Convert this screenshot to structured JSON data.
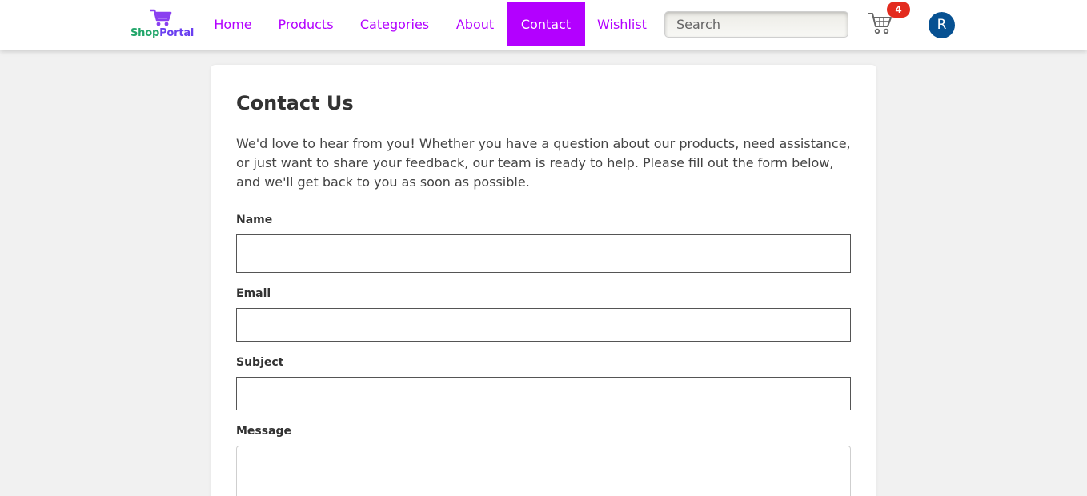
{
  "brand": {
    "name_part1": "Shop",
    "name_part2": "Portal",
    "icon": "shopping-cart-icon"
  },
  "nav": {
    "items": [
      {
        "label": "Home",
        "active": false
      },
      {
        "label": "Products",
        "active": false
      },
      {
        "label": "Categories",
        "active": false
      },
      {
        "label": "About",
        "active": false
      },
      {
        "label": "Contact",
        "active": true
      },
      {
        "label": "Wishlist",
        "active": false
      }
    ]
  },
  "search": {
    "placeholder": "Search",
    "value": ""
  },
  "cart": {
    "icon": "cart-icon",
    "count": "4"
  },
  "user": {
    "initial": "R"
  },
  "contact": {
    "title": "Contact Us",
    "intro": "We'd love to hear from you! Whether you have a question about our products, need assistance, or just want to share your feedback, our team is ready to help. Please fill out the form below, and we'll get back to you as soon as possible.",
    "fields": {
      "name": {
        "label": "Name",
        "value": ""
      },
      "email": {
        "label": "Email",
        "value": ""
      },
      "subject": {
        "label": "Subject",
        "value": ""
      },
      "message": {
        "label": "Message",
        "value": ""
      }
    }
  },
  "colors": {
    "accent": "#b300ff",
    "badge": "#e32b1e",
    "avatar": "#075192",
    "background": "#f1f1f1",
    "brand_green": "#22a66a",
    "brand_purple": "#6a3ff0"
  }
}
